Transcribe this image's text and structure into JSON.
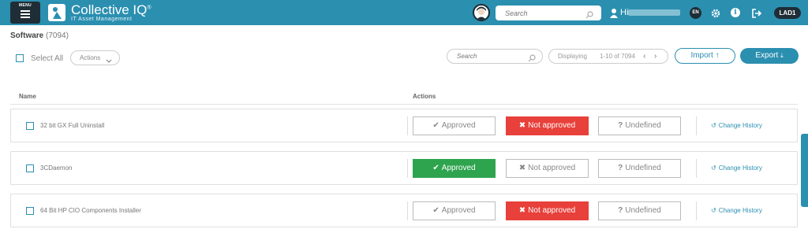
{
  "topbar": {
    "menu_label": "MENU",
    "brand_title": "Collective IQ",
    "brand_trademark": "®",
    "brand_subtitle": "IT Asset Management",
    "search_placeholder": "Search",
    "greeting": "Hi",
    "language": "EN",
    "site_code": "LAD1",
    "accent_color": "#2b8fb0",
    "dark_color": "#1f2d36"
  },
  "page": {
    "title": "Software",
    "count": "(7094)"
  },
  "toolbar": {
    "select_all_label": "Select All",
    "actions_label": "Actions",
    "search_placeholder": "Search",
    "displaying_label": "Displaying",
    "range_label": "1-10 of 7094",
    "prev_symbol": "‹",
    "next_symbol": "›",
    "import_label": "Import",
    "export_label": "Export"
  },
  "table": {
    "columns": [
      "Name",
      "Actions"
    ],
    "approved_label": "Approved",
    "not_approved_label": "Not approved",
    "undefined_label": "Undefined",
    "history_label": "Change History",
    "rows": [
      {
        "name": "32 bit GX Full Uninstall",
        "status": "not_approved"
      },
      {
        "name": "3CDaemon",
        "status": "approved"
      },
      {
        "name": "64 Bit HP CIO Components Installer",
        "status": "not_approved"
      }
    ]
  },
  "colors": {
    "approved": "#2ea44f",
    "not_approved": "#e8403a"
  }
}
